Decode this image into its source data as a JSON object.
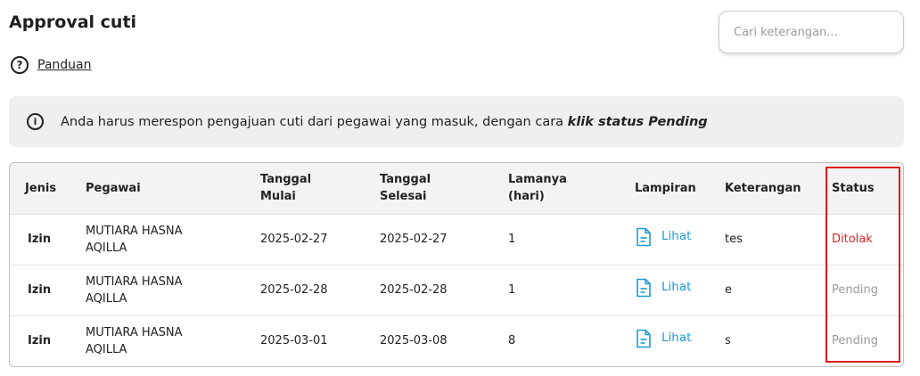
{
  "header": {
    "title": "Approval cuti",
    "guide_label": "Panduan"
  },
  "search": {
    "placeholder": "Cari keterangan...",
    "value": ""
  },
  "info": {
    "text": "Anda harus merespon pengajuan cuti dari pegawai yang masuk, dengan cara ",
    "emphasis": "klik status Pending"
  },
  "table": {
    "columns": [
      "Jenis",
      "Pegawai",
      "Tanggal Mulai",
      "Tanggal Selesai",
      "Lamanya (hari)",
      "Lampiran",
      "Keterangan",
      "Status"
    ],
    "rows": [
      {
        "jenis": "Izin",
        "pegawai": "MUTIARA HASNA AQILLA",
        "mulai": "2025-02-27",
        "selesai": "2025-02-27",
        "lama": "1",
        "lampiran": "Lihat",
        "keterangan": "tes",
        "status": "Ditolak"
      },
      {
        "jenis": "Izin",
        "pegawai": "MUTIARA HASNA AQILLA",
        "mulai": "2025-02-28",
        "selesai": "2025-02-28",
        "lama": "1",
        "lampiran": "Lihat",
        "keterangan": "e",
        "status": "Pending"
      },
      {
        "jenis": "Izin",
        "pegawai": "MUTIARA HASNA AQILLA",
        "mulai": "2025-03-01",
        "selesai": "2025-03-08",
        "lama": "8",
        "lampiran": "Lihat",
        "keterangan": "s",
        "status": "Pending"
      }
    ]
  },
  "colors": {
    "link": "#1a9bd7",
    "rejected": "#e02424",
    "pending": "#9a9a9a",
    "highlight": "#e01b1b"
  },
  "icons": {
    "guide": "question-circle-icon",
    "info": "info-circle-icon",
    "attachment": "document-icon"
  }
}
